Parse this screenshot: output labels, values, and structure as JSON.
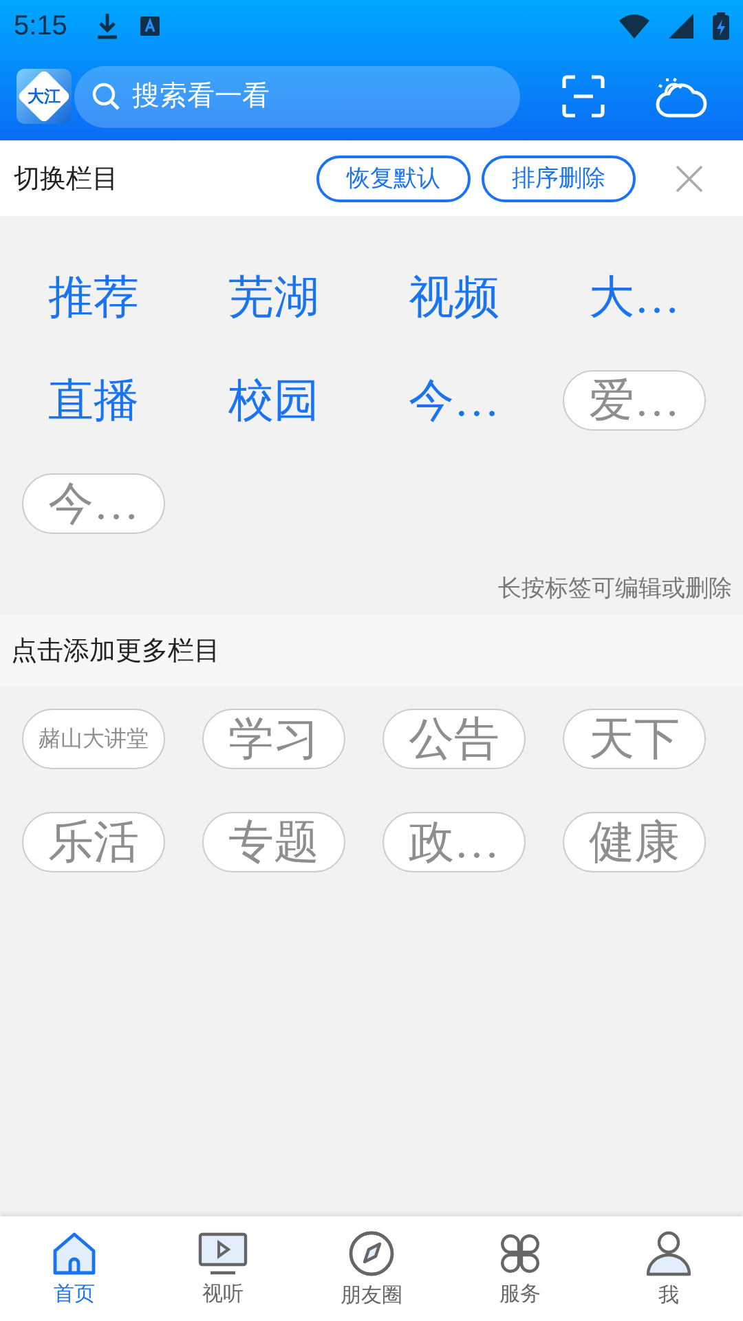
{
  "status_bar": {
    "time": "5:15"
  },
  "header": {
    "logo_text": "大江",
    "search": {
      "placeholder": "搜索看一看"
    }
  },
  "my_channels": {
    "title": "切换栏目",
    "buttons": [
      "恢复默认",
      "排序删除"
    ],
    "hint": "长按标签可编辑或删除",
    "items": [
      {
        "label": "推荐",
        "kind": "fixed"
      },
      {
        "label": "芜湖",
        "kind": "fixed"
      },
      {
        "label": "视频",
        "kind": "fixed"
      },
      {
        "label": "大…",
        "kind": "fixed"
      },
      {
        "label": "直播",
        "kind": "fixed"
      },
      {
        "label": "校园",
        "kind": "fixed"
      },
      {
        "label": "今…",
        "kind": "fixed"
      },
      {
        "label": "爱…",
        "kind": "tag"
      },
      {
        "label": "今…",
        "kind": "tag"
      }
    ]
  },
  "more_channels": {
    "title": "点击添加更多栏目",
    "items": [
      {
        "label": "赭山大讲堂",
        "kind": "small"
      },
      {
        "label": "学习",
        "kind": "tag"
      },
      {
        "label": "公告",
        "kind": "tag"
      },
      {
        "label": "天下",
        "kind": "tag"
      },
      {
        "label": "乐活",
        "kind": "tag"
      },
      {
        "label": "专题",
        "kind": "tag"
      },
      {
        "label": "政…",
        "kind": "tag"
      },
      {
        "label": "健康",
        "kind": "tag"
      }
    ]
  },
  "bottom_nav": [
    {
      "label": "首页",
      "selected": true
    },
    {
      "label": "视听",
      "selected": false
    },
    {
      "label": "朋友圈",
      "selected": false
    },
    {
      "label": "服务",
      "selected": false
    },
    {
      "label": "我",
      "selected": false
    }
  ]
}
